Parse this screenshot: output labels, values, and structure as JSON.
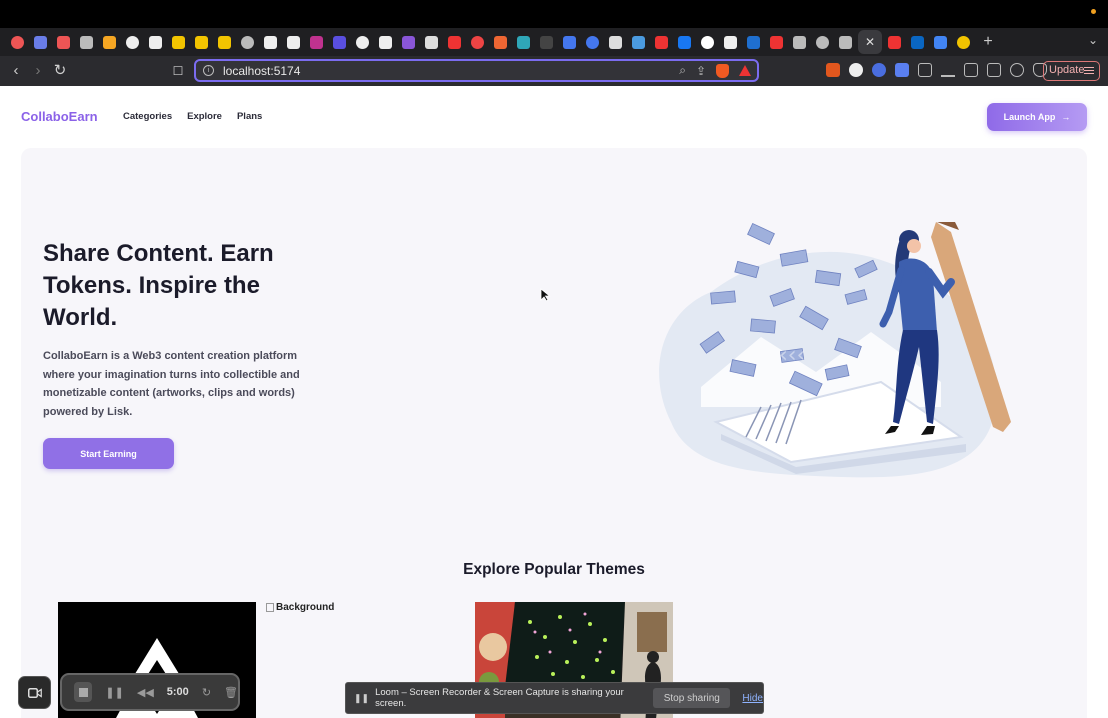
{
  "browser": {
    "url": "localhost:5174",
    "update_label": "Update",
    "new_tab_symbol": "+",
    "close_tab_symbol": "✕",
    "tab_favicon_colors": [
      "#e55",
      "#6a7de8",
      "#e55",
      "#bbb",
      "#f5a623",
      "#eee",
      "#eee",
      "#f2c400",
      "#f2c400",
      "#f2c400",
      "#bbb",
      "#eee",
      "#eee",
      "#c0328f",
      "#5a4fe0",
      "#eee",
      "#eee",
      "#8a56d8",
      "#ddd",
      "#e33",
      "#e44",
      "#ee6633",
      "#2fa7b8",
      "#444",
      "#4477ee",
      "#4477ee",
      "#ddd",
      "#4b9be0",
      "#e33",
      "#1877f2",
      "#fff",
      "#eee",
      "#1f6fcf",
      "#e33",
      "#bbb",
      "#bbb",
      "#bbb",
      "#e33",
      "#0a66c2",
      "#4285f4",
      "#f2c400"
    ]
  },
  "site": {
    "logo": "CollaboEarn",
    "nav": [
      "Categories",
      "Explore",
      "Plans"
    ],
    "launch_label": "Launch App"
  },
  "hero": {
    "title": "Share Content. Earn Tokens. Inspire the World.",
    "description": "CollaboEarn is a Web3 content creation platform where your imagination turns into collectible and monetizable content (artworks, clips and words) powered by Lisk.",
    "cta_label": "Start Earning"
  },
  "themes": {
    "title": "Explore Popular Themes",
    "broken_image_alt": "Background"
  },
  "loom": {
    "timer": "5:00",
    "share_message": "Loom – Screen Recorder & Screen Capture is sharing your screen.",
    "stop_label": "Stop sharing",
    "hide_label": "Hide"
  },
  "colors": {
    "accent": "#8b62e8",
    "chrome_bg": "#1f1f22",
    "url_focus_border": "#7b6cf0"
  }
}
